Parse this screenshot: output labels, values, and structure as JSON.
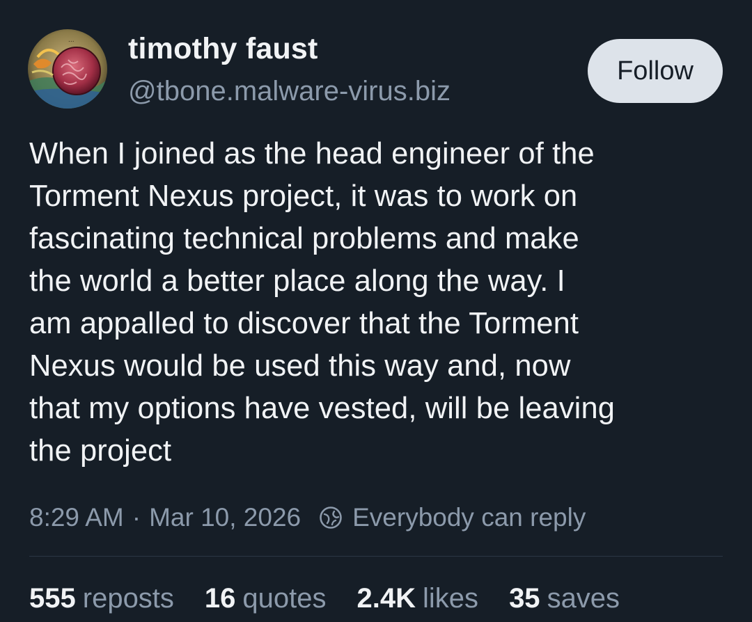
{
  "author": {
    "display_name": "timothy faust",
    "handle": "@tbone.malware-virus.biz",
    "avatar_icon": "painted-brain-avatar"
  },
  "follow_button": {
    "label": "Follow"
  },
  "post": {
    "text": "When I joined as the head engineer of the\nTorment Nexus project, it was to work on\nfascinating technical problems and make\nthe world a better place along the way. I\nam appalled to discover that the Torment\nNexus would be used this way and, now\nthat my options have vested, will be leaving\nthe project",
    "time": "8:29 AM",
    "separator": "·",
    "date": "Mar 10, 2026",
    "reply_setting": "Everybody can reply",
    "reply_icon": "globe-icon"
  },
  "stats": [
    {
      "count": "555",
      "label": "reposts"
    },
    {
      "count": "16",
      "label": "quotes"
    },
    {
      "count": "2.4K",
      "label": "likes"
    },
    {
      "count": "35",
      "label": "saves"
    }
  ],
  "colors": {
    "background": "#161e27",
    "text": "#f1f3f5",
    "muted": "#8c9aab",
    "follow_bg": "#dde3ea"
  }
}
